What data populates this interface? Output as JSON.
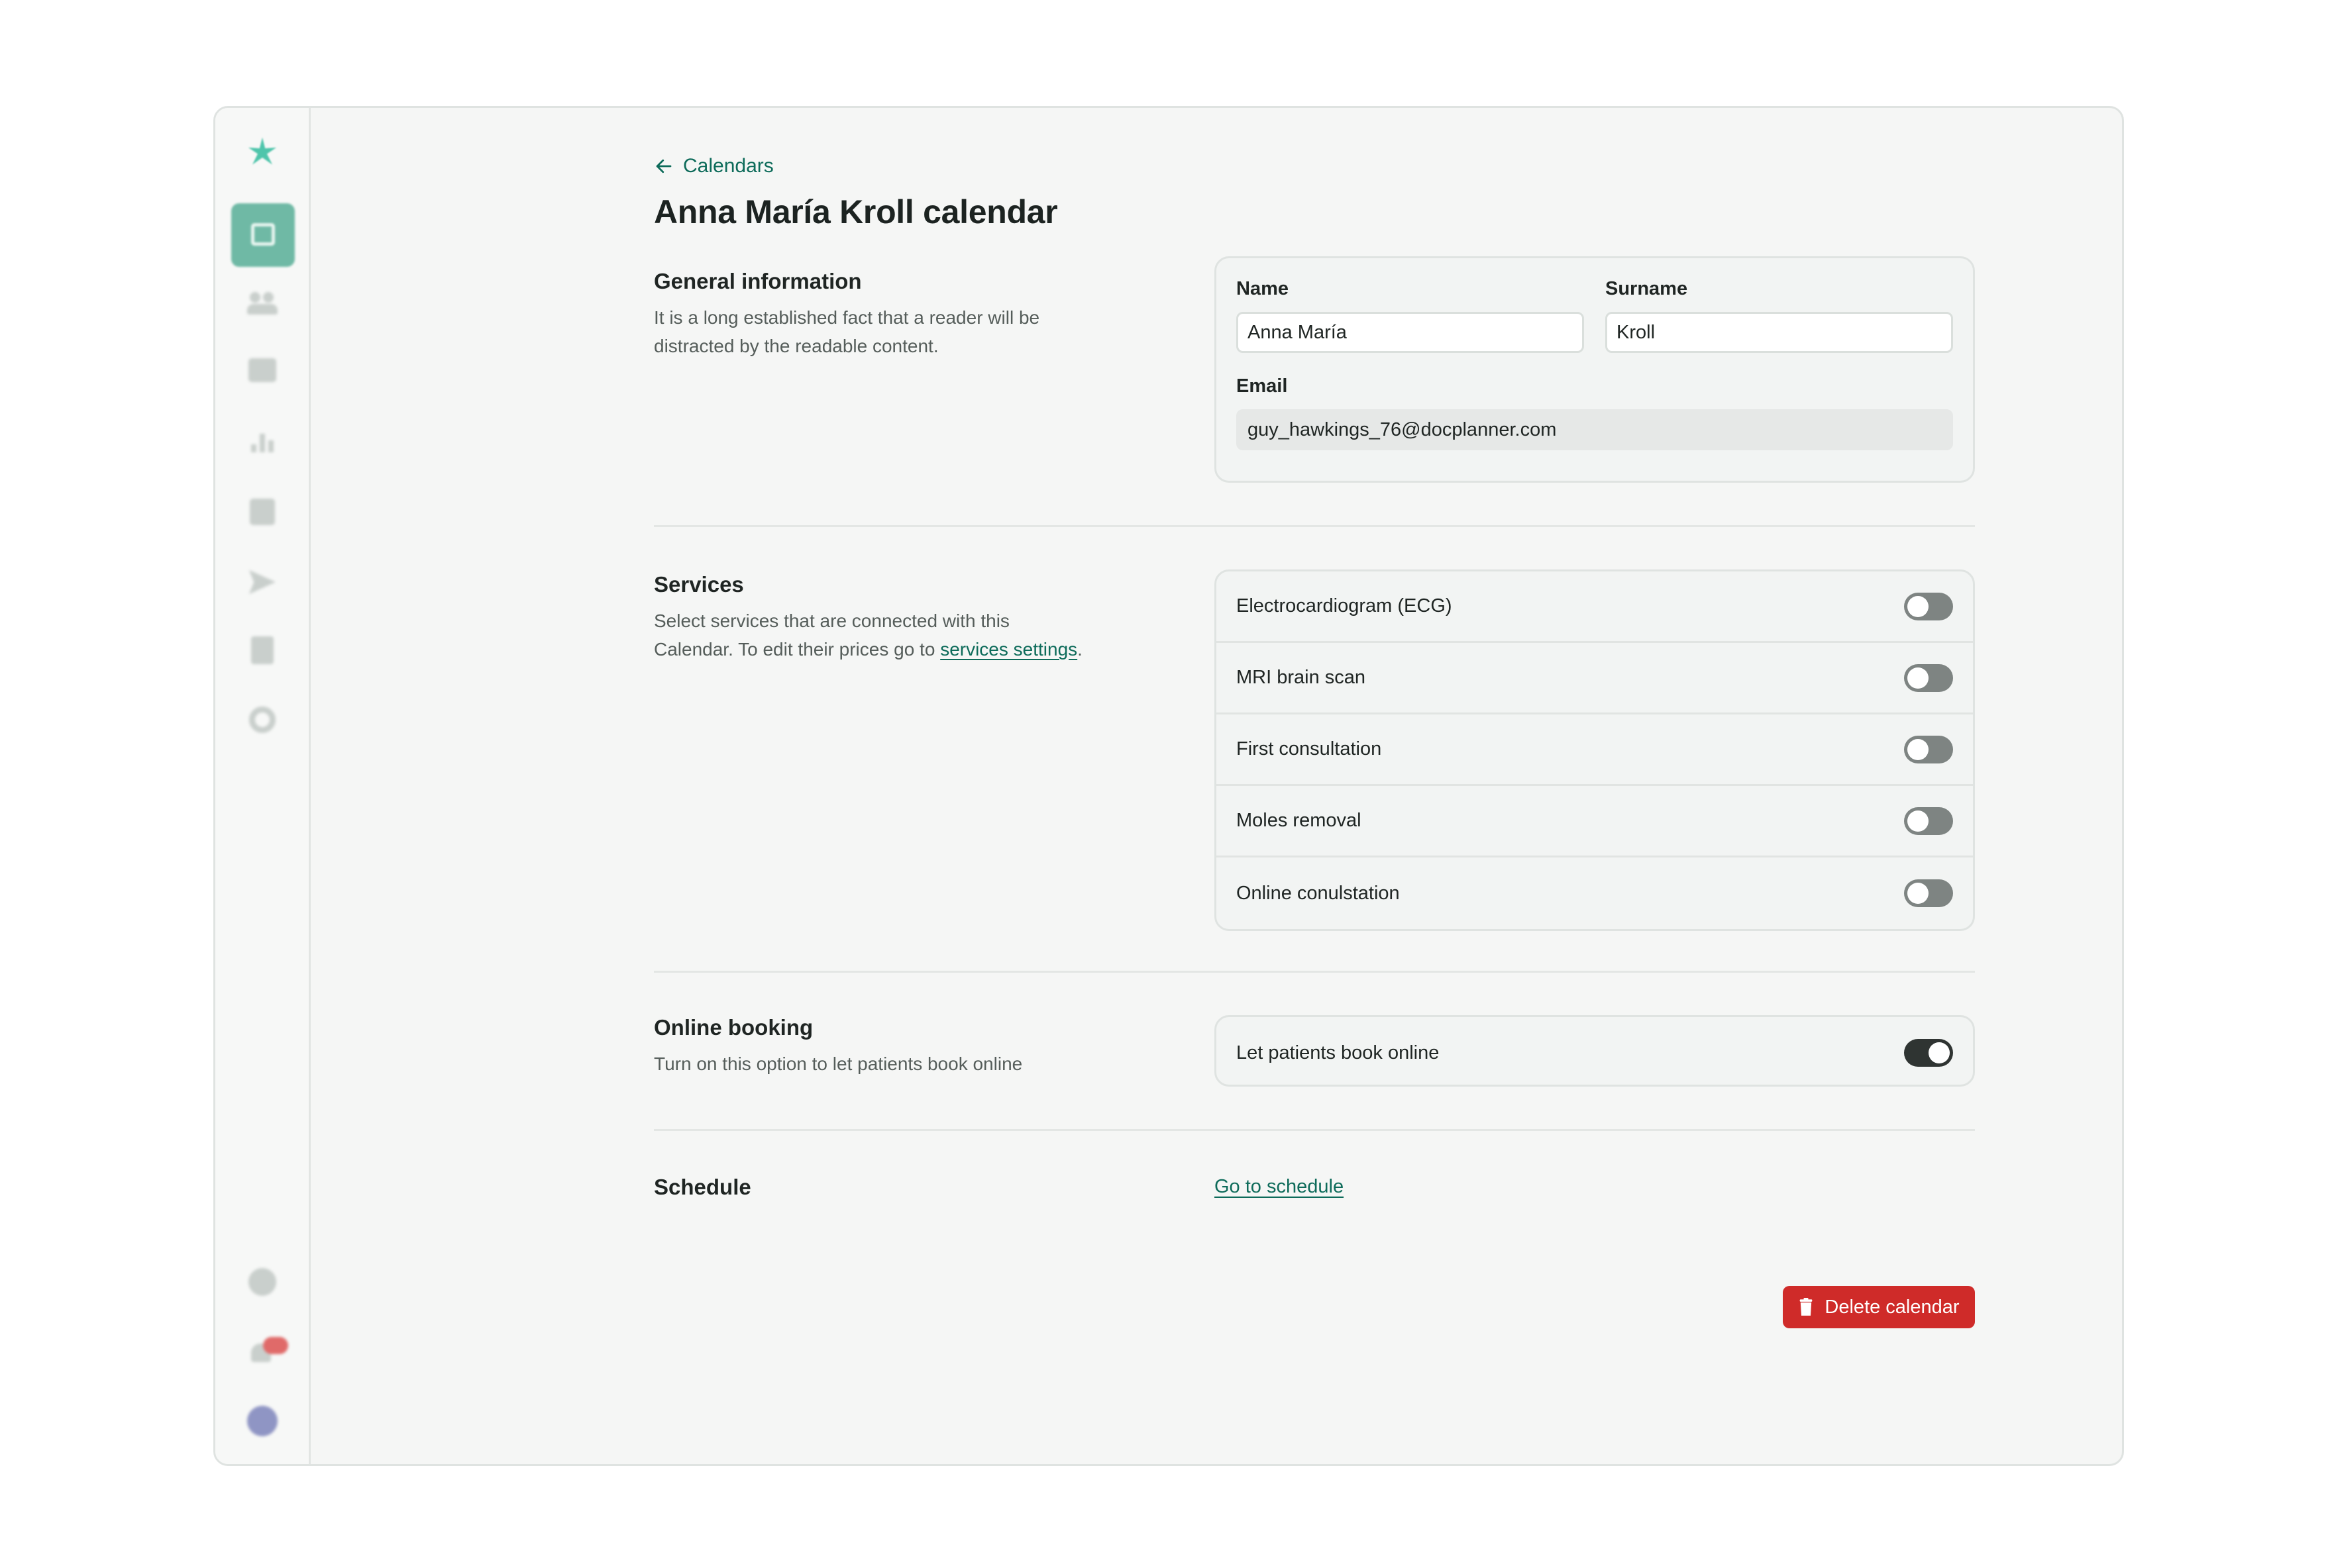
{
  "nav": {
    "back_label": "Calendars"
  },
  "page": {
    "title": "Anna María Kroll calendar"
  },
  "general": {
    "heading": "General information",
    "description": "It is a long established fact that a reader will be distracted by the readable content.",
    "name_label": "Name",
    "name_value": "Anna María",
    "surname_label": "Surname",
    "surname_value": "Kroll",
    "email_label": "Email",
    "email_value": "guy_hawkings_76@docplanner.com"
  },
  "services": {
    "heading": "Services",
    "description_prefix": "Select services that are connected with this Calendar. To edit their prices go to ",
    "description_link": "services settings",
    "description_suffix": ".",
    "items": [
      {
        "label": "Electrocardiogram (ECG)",
        "enabled": false
      },
      {
        "label": "MRI brain scan",
        "enabled": false
      },
      {
        "label": "First consultation",
        "enabled": false
      },
      {
        "label": "Moles removal",
        "enabled": false
      },
      {
        "label": "Online conulstation",
        "enabled": false
      }
    ]
  },
  "online_booking": {
    "heading": "Online booking",
    "description": "Turn on this option to let patients book online",
    "toggle_label": "Let patients book online",
    "enabled": true
  },
  "schedule": {
    "heading": "Schedule",
    "link_label": "Go to schedule"
  },
  "actions": {
    "delete_label": "Delete calendar"
  },
  "colors": {
    "accent": "#0d6b5a",
    "danger": "#cf2b29",
    "brand": "#4fc5ab"
  }
}
